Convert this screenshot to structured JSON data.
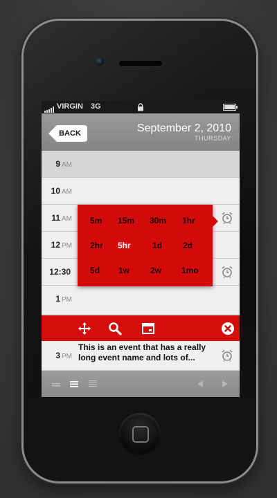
{
  "status_bar": {
    "carrier": "VIRGIN",
    "network": "3G"
  },
  "header": {
    "back_label": "BACK",
    "date": "September 2, 2010",
    "weekday": "THURSDAY"
  },
  "rows": [
    {
      "hour": "9",
      "ampm": "AM"
    },
    {
      "hour": "10",
      "ampm": "AM"
    },
    {
      "hour": "11",
      "ampm": "AM"
    },
    {
      "hour": "12",
      "ampm": "PM"
    },
    {
      "hour": "12:30",
      "ampm": ""
    },
    {
      "hour": "1",
      "ampm": "PM"
    },
    {
      "hour": "3",
      "ampm": "PM",
      "event": "This is an event that has a really long event name and lots of..."
    }
  ],
  "reminder_options": [
    "5m",
    "15m",
    "30m",
    "1hr",
    "2hr",
    "5hr",
    "1d",
    "2d",
    "5d",
    "1w",
    "2w",
    "1mo"
  ],
  "selected_option": "5hr",
  "colors": {
    "accent_red": "#d50a0a",
    "header_gray": "#8a8a8a",
    "status_bar": "#1a1a1a"
  },
  "icons": {
    "toolbar": [
      "move-icon",
      "search-icon",
      "calendar-icon",
      "close-icon"
    ],
    "bottom_bar": [
      "view-compact-icon",
      "view-list-icon",
      "view-detail-icon",
      "prev-arrow-icon",
      "next-arrow-icon"
    ]
  }
}
